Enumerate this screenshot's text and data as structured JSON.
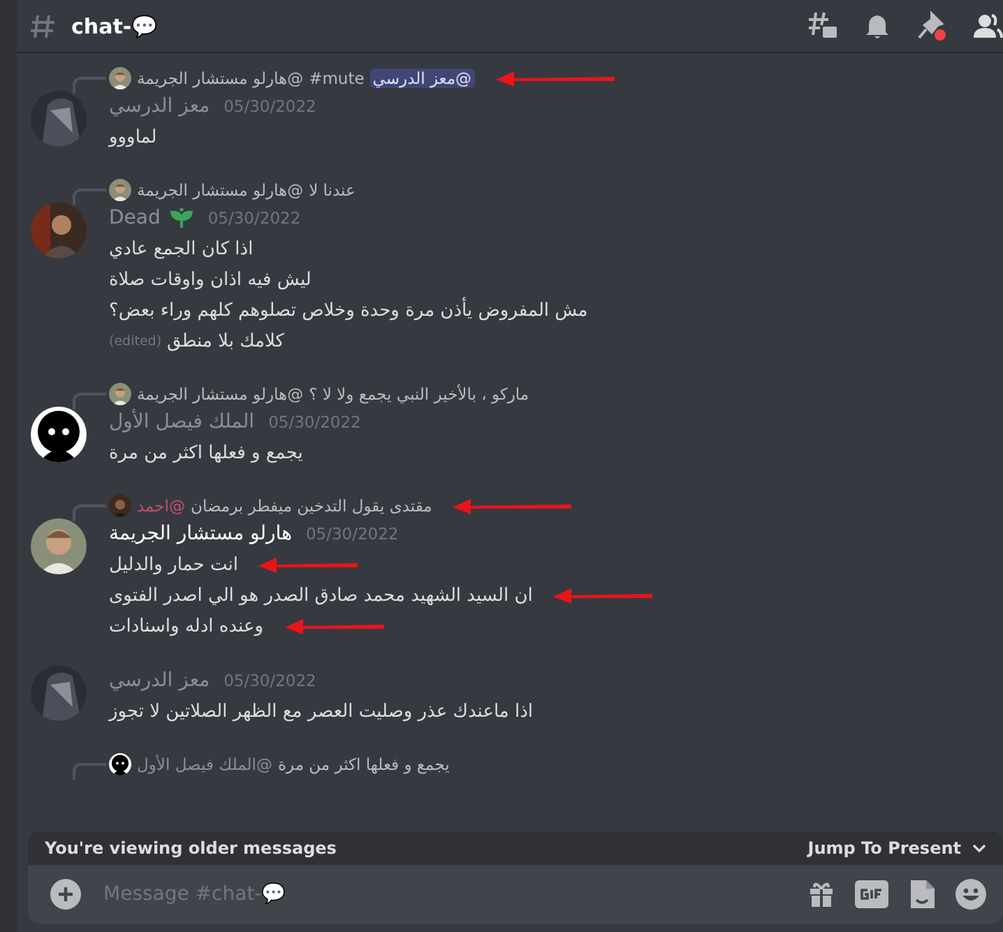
{
  "channel": {
    "name": "chat-",
    "emoji": "💬"
  },
  "messages": [
    {
      "reply": {
        "author": "@هارلو مستشار الجريمة",
        "color": "#b9bbbe",
        "avatar": {
          "kind": "photo"
        },
        "parts": [
          {
            "kind": "mention",
            "text": "@معز الدرسي"
          },
          {
            "kind": "channel",
            "text": "#mute"
          }
        ],
        "arrow": true
      },
      "author": "معز الدرسي",
      "color": "#8a8e96",
      "avatar": {
        "kind": "hood"
      },
      "badge": false,
      "date": "05/30/2022",
      "lines": [
        {
          "text": "لماووو",
          "arrow": false
        }
      ]
    },
    {
      "reply": {
        "author": "@هارلو مستشار الجريمة",
        "color": "#b9bbbe",
        "avatar": {
          "kind": "photo"
        },
        "parts": [
          {
            "kind": "text",
            "text": "عندنا لا"
          }
        ],
        "arrow": false
      },
      "author": "Dead",
      "color": "#8a8e96",
      "avatar": {
        "kind": "photo2"
      },
      "badge": true,
      "date": "05/30/2022",
      "lines": [
        {
          "text": "اذا كان الجمع عادي",
          "arrow": false
        },
        {
          "text": "ليش فيه اذان واوقات صلاة",
          "arrow": false
        },
        {
          "text": "مش المفروض يأذن مرة وحدة وخلاص تصلوهم كلهم وراء بعض؟",
          "arrow": false
        },
        {
          "text": "كلامك بلا منطق",
          "edited": "(edited)",
          "arrow": false
        }
      ]
    },
    {
      "reply": {
        "author": "@هارلو مستشار الجريمة",
        "color": "#b9bbbe",
        "avatar": {
          "kind": "photo"
        },
        "parts": [
          {
            "kind": "text",
            "text": "ماركو ، بالأخير النبي يجمع ولا لا ؟"
          }
        ],
        "arrow": false
      },
      "author": "الملك فيصل الأول",
      "color": "#8a8e96",
      "avatar": {
        "kind": "creature"
      },
      "badge": false,
      "date": "05/30/2022",
      "lines": [
        {
          "text": "يجمع و فعلها اكثر من مرة",
          "arrow": false
        }
      ]
    },
    {
      "reply": {
        "author": "@احمد",
        "color": "#c0506e",
        "avatar": {
          "kind": "photo3"
        },
        "parts": [
          {
            "kind": "text",
            "text": "مقتدى يقول التدخين ميفطر برمضان"
          }
        ],
        "arrow": true
      },
      "author": "هارلو مستشار الجريمة",
      "color": "#ffffff",
      "avatar": {
        "kind": "photo"
      },
      "badge": false,
      "date": "05/30/2022",
      "lines": [
        {
          "text": "انت حمار والدليل",
          "arrow": true
        },
        {
          "text": "ان السيد الشهيد محمد صادق الصدر هو الي اصدر الفتوى",
          "arrow": true
        },
        {
          "text": "وعنده ادله واسنادات",
          "arrow": true
        }
      ]
    },
    {
      "author": "معز الدرسي",
      "color": "#8a8e96",
      "avatar": {
        "kind": "hood"
      },
      "badge": false,
      "date": "05/30/2022",
      "lines": [
        {
          "text": "اذا ماعندك عذر وصليت العصر مع الظهر الصلاتين لا تجوز",
          "arrow": false
        }
      ]
    }
  ],
  "last_reply": {
    "author": "@الملك فيصل الأول",
    "color": "#8a8e96",
    "avatar": {
      "kind": "creature"
    },
    "parts": [
      {
        "kind": "text",
        "text": "يجمع و فعلها اكثر من مرة"
      }
    ],
    "arrow": false
  },
  "older_bar": {
    "text": "You're viewing older messages",
    "action": "Jump To Present"
  },
  "composer": {
    "placeholder": "Message #chat-💬"
  }
}
